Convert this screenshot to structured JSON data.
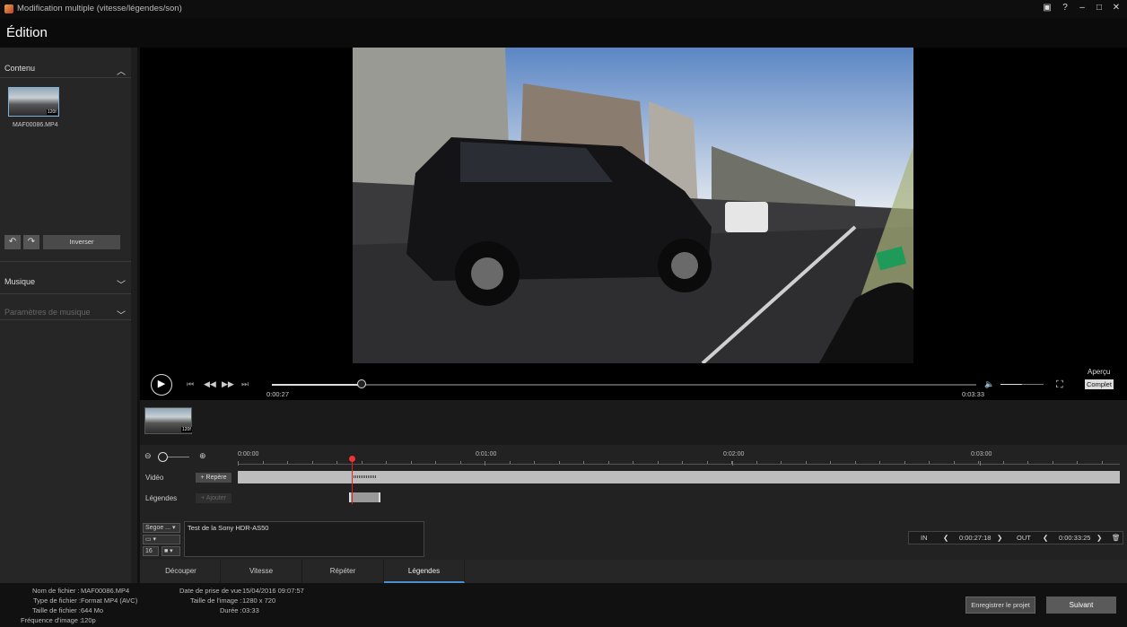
{
  "window": {
    "title": "Modification multiple (vitesse/légendes/son)"
  },
  "header": {
    "title": "Édition"
  },
  "left_panel": {
    "content_label": "Contenu",
    "thumb": {
      "filename": "MAF00086.MP4",
      "badge": "120f"
    },
    "invert_label": "Inverser",
    "music_label": "Musique",
    "music_params_label": "Paramètres de musique"
  },
  "player": {
    "current_time": "0:00:27",
    "total_time": "0:03:33",
    "progress": 0.128,
    "volume": 0.5,
    "preview_label": "Aperçu",
    "preview_mode": "Complet"
  },
  "timeline": {
    "ticks": [
      "0:00:00",
      "0:01:00",
      "0:02:00",
      "0:03:00"
    ],
    "video_label": "Vidéo",
    "caption_label": "Légendes",
    "marker_button": "Repère",
    "add_button": "Ajouter",
    "strip_badge": "120f"
  },
  "caption_editor": {
    "font": "Segoe ...",
    "size": "16",
    "text": "Test de la Sony HDR-AS50",
    "in_label": "IN",
    "in_time": "0:00:27:18",
    "out_label": "OUT",
    "out_time": "0:00:33:25"
  },
  "tabs": [
    "Découper",
    "Vitesse",
    "Répéter",
    "Légendes"
  ],
  "file_info": {
    "name_label": "Nom de fichier :",
    "name": "MAF00086.MP4",
    "type_label": "Type de fichier :",
    "type": "Format MP4 (AVC)",
    "size_label": "Taille de fichier :",
    "size": "644 Mo",
    "fps_label": "Fréquence d'image :",
    "fps": "120p",
    "date_label": "Date de prise de vue :",
    "date": "15/04/2016 09:07:57",
    "dims_label": "Taille de l'image :",
    "dims": "1280 x 720",
    "duration_label": "Durée :",
    "duration": "03:33"
  },
  "footer": {
    "save_label": "Enregistrer le projet",
    "next_label": "Suivant"
  }
}
